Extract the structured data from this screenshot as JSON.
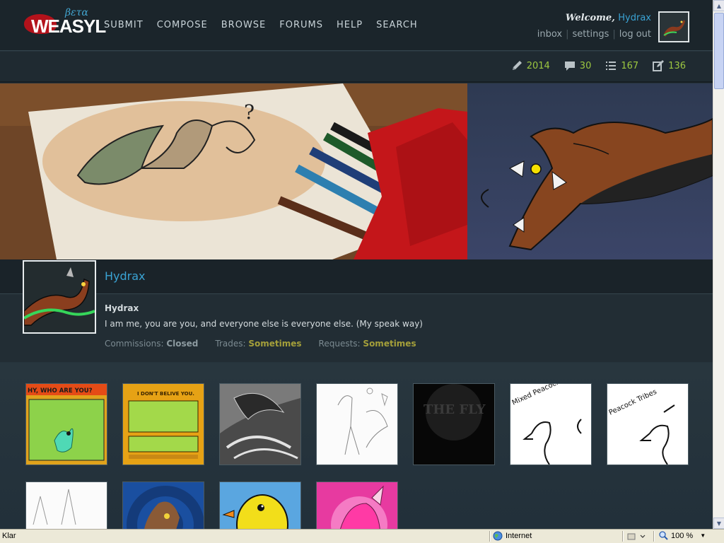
{
  "site": {
    "logo_text": "WEASYL",
    "beta_label": "βετα"
  },
  "nav": {
    "items": [
      "Submit",
      "Compose",
      "Browse",
      "Forums",
      "Help",
      "Search"
    ]
  },
  "user": {
    "welcome_prefix": "Welcome,",
    "username": "Hydrax",
    "menu": [
      "inbox",
      "settings",
      "log out"
    ]
  },
  "stats": [
    {
      "icon": "pencil-icon",
      "value": "2014"
    },
    {
      "icon": "comment-icon",
      "value": "30"
    },
    {
      "icon": "list-icon",
      "value": "167"
    },
    {
      "icon": "edit-note-icon",
      "value": "136"
    }
  ],
  "profile": {
    "display_name": "Hydrax",
    "username": "Hydrax",
    "bio": "I am me, you are you, and everyone else is everyone else. (My speak way)",
    "commissions_label": "Commissions:",
    "commissions_value": "Closed",
    "trades_label": "Trades:",
    "trades_value": "Sometimes",
    "requests_label": "Requests:",
    "requests_value": "Sometimes"
  },
  "gallery": {
    "thumbs": [
      {
        "text": "HY, WHO ARE YOU?"
      },
      {
        "text": "I DON'T BELIVE YOU."
      },
      {
        "text": ""
      },
      {
        "text": ""
      },
      {
        "text": "THE FLY"
      },
      {
        "text": "Mixed Peacocks"
      },
      {
        "text": "Peacock Tribes"
      },
      {
        "text": ""
      },
      {
        "text": ""
      },
      {
        "text": ""
      },
      {
        "text": ""
      }
    ]
  },
  "browser": {
    "status_text": "Klar",
    "zone": "Internet",
    "zoom": "100 %"
  },
  "colors": {
    "accent_blue": "#3aa3d4",
    "stat_green": "#9cc740",
    "status_gold": "#a49f3a"
  }
}
